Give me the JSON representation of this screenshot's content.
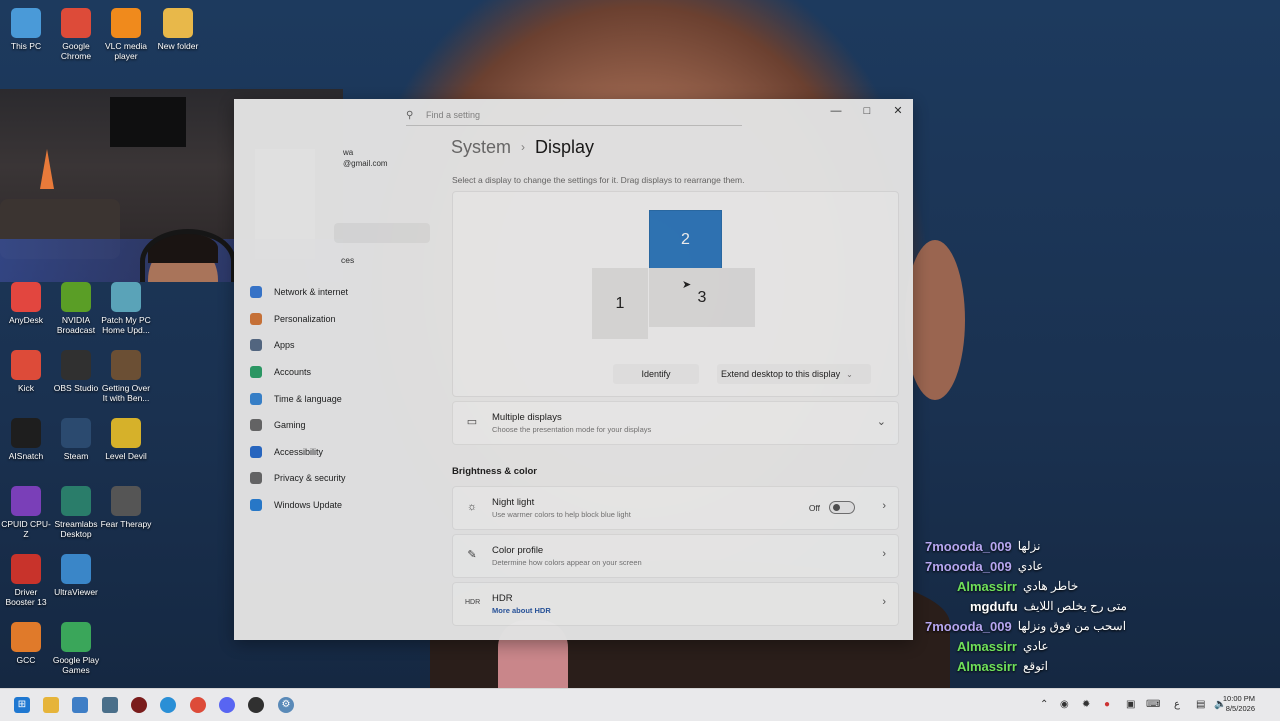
{
  "desktop": {
    "icons": [
      {
        "label": "This PC",
        "icon": "monitor-icon",
        "color": "#4a9ad8"
      },
      {
        "label": "Google Chrome",
        "icon": "chrome-icon",
        "color": "#dd4b39"
      },
      {
        "label": "VLC media player",
        "icon": "vlc-cone-icon",
        "color": "#f08a1c"
      },
      {
        "label": "New folder",
        "icon": "folder-icon",
        "color": "#e8b84a"
      },
      {
        "label": "AnyDesk",
        "icon": "anydesk-icon",
        "color": "#e2463f"
      },
      {
        "label": "NVIDIA Broadcast",
        "icon": "nvidia-icon",
        "color": "#5a9e26"
      },
      {
        "label": "Patch My PC Home Upd...",
        "icon": "house-icon",
        "color": "#5aa3b8"
      },
      {
        "label": "Kick",
        "icon": "kick-icon",
        "color": "#dd4b39"
      },
      {
        "label": "OBS Studio",
        "icon": "obs-icon",
        "color": "#303030"
      },
      {
        "label": "Getting Over It with Ben...",
        "icon": "hammer-icon",
        "color": "#6b4f34"
      },
      {
        "label": "AISnatch",
        "icon": "aisnatch-icon",
        "color": "#1e1e1e"
      },
      {
        "label": "Steam",
        "icon": "steam-icon",
        "color": "#2b4a6f"
      },
      {
        "label": "Level Devil",
        "icon": "level-devil-icon",
        "color": "#d6b12a"
      },
      {
        "label": "CPUID CPU-Z",
        "icon": "cpuz-icon",
        "color": "#7a3fb8"
      },
      {
        "label": "Streamlabs Desktop",
        "icon": "streamlabs-icon",
        "color": "#2a7d6a"
      },
      {
        "label": "Fear Therapy",
        "icon": "fear-therapy-icon",
        "color": "#555555"
      },
      {
        "label": "Driver Booster 13",
        "icon": "driver-booster-icon",
        "color": "#c8332b"
      },
      {
        "label": "UltraViewer",
        "icon": "ultraviewer-icon",
        "color": "#3a86c8"
      },
      {
        "label": "GCC",
        "icon": "gcc-icon",
        "color": "#e07a2a"
      },
      {
        "label": "Google Play Games",
        "icon": "play-games-icon",
        "color": "#3aa65a"
      }
    ]
  },
  "settings": {
    "search_placeholder": "Find a setting",
    "account_name_fragment": "wa",
    "account_email_fragment": "@gmail.com",
    "side_partial_item": "ces",
    "nav": [
      {
        "label": "Network & internet",
        "icon": "wifi-icon",
        "color": "#3b7dd8"
      },
      {
        "label": "Personalization",
        "icon": "brush-icon",
        "color": "#d87b3b"
      },
      {
        "label": "Apps",
        "icon": "apps-icon",
        "color": "#5a6f8a"
      },
      {
        "label": "Accounts",
        "icon": "person-icon",
        "color": "#2fa36b"
      },
      {
        "label": "Time & language",
        "icon": "globe-clock-icon",
        "color": "#3b8ad8"
      },
      {
        "label": "Gaming",
        "icon": "gamepad-icon",
        "color": "#6d6d6d"
      },
      {
        "label": "Accessibility",
        "icon": "accessibility-icon",
        "color": "#2b6fd0"
      },
      {
        "label": "Privacy & security",
        "icon": "shield-icon",
        "color": "#6d6d6d"
      },
      {
        "label": "Windows Update",
        "icon": "update-icon",
        "color": "#2b82d9"
      }
    ],
    "breadcrumb_parent": "System",
    "breadcrumb_current": "Display",
    "breadcrumb_sep": "›",
    "hint": "Select a display to change the settings for it. Drag displays to rearrange them.",
    "monitors": {
      "m1": "1",
      "m2": "2",
      "m3": "3"
    },
    "identify_label": "Identify",
    "extend_label": "Extend desktop to this display",
    "multiple_displays": {
      "title": "Multiple displays",
      "subtitle": "Choose the presentation mode for your displays"
    },
    "brightness_heading": "Brightness & color",
    "night_light": {
      "title": "Night light",
      "subtitle": "Use warmer colors to help block blue light",
      "state": "Off"
    },
    "color_profile": {
      "title": "Color profile",
      "subtitle": "Determine how colors appear on your screen"
    },
    "hdr": {
      "title": "HDR",
      "link": "More about HDR"
    }
  },
  "chat": [
    {
      "user": "7moooda_009",
      "msg": "نزلها",
      "color": "#b6a6f0"
    },
    {
      "user": "7moooda_009",
      "msg": "عادي",
      "color": "#b6a6f0"
    },
    {
      "user": "Almassirr",
      "msg": "خاطر هادي",
      "color": "#6fe05a"
    },
    {
      "user": "mgdufu",
      "msg": "متى رح يخلص اللايف",
      "color": "#ffffff"
    },
    {
      "user": "7moooda_009",
      "msg": "اسحب من فوق ونزلها",
      "color": "#b6a6f0"
    },
    {
      "user": "Almassirr",
      "msg": "عادي",
      "color": "#6fe05a"
    },
    {
      "user": "Almassirr",
      "msg": "اتوقع",
      "color": "#6fe05a"
    }
  ],
  "taskbar": {
    "clock_time": "10:00 PM",
    "clock_date": "8/5/2026",
    "lang": "ع"
  }
}
